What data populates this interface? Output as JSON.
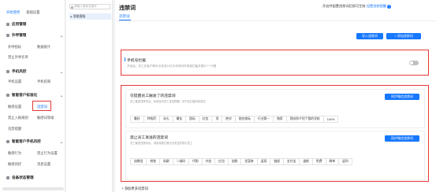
{
  "sidebar": {
    "groups": [
      {
        "label": "应用管理"
      },
      {
        "label": "外呼管理",
        "subs": [
          "外呼指标",
          "数据统计",
          "禁止外呼名单"
        ]
      },
      {
        "label": "手机风控",
        "subs": [
          "手机设置",
          "手机权限"
        ]
      },
      {
        "label": "智能客户标准化",
        "subs": [
          "敏感设置",
          "违禁词",
          "禁止入群规则",
          "敏感词等级",
          "违禁提醒"
        ]
      },
      {
        "label": "智能客户手机风控",
        "subs": [
          "敏感行为",
          "禁止行为设置",
          "敏感风控",
          "消息设置"
        ]
      },
      {
        "label": "设备状态管理"
      }
    ],
    "top_items": [
      "开始使用",
      "基础设置"
    ]
  },
  "midpanel": {
    "search_placeholder": "请输入搜索关键字",
    "tree_root": "智能客服"
  },
  "main": {
    "title": "违禁词",
    "hint": "开启并配置违禁词后即可生效·",
    "hint_link": "设置违禁提醒",
    "hint_q": "?",
    "tab": "违禁词",
    "btn_import": "导入违禁词",
    "btn_add": "+ 添加违禁词",
    "sec1_label": "手机号拦截",
    "sec1_desc": "开启后，员工在客户聊天中发送11位手机号码时将被拦截并提示\"**\"代替",
    "card1": {
      "title": "仅提醒员工触发了的违禁词",
      "desc": "员工触发违禁词后，系统会向员工发送提醒，但不会拦截消息发送",
      "btn": "同步微信违禁词",
      "tags": [
        "最好",
        "特效药",
        "永久",
        "最佳",
        "国际",
        "红包",
        "顶",
        "绝对",
        "驰名商标",
        "行业第一",
        "独家",
        "我向你介绍个我的学校",
        "100%"
      ]
    },
    "card2": {
      "title": "禁止员工发送的违禁词",
      "desc": "员工触发违禁词后，消息将被拦截无法发送并提示员工",
      "btn": "同步微信违禁词",
      "tags": [
        "加微信",
        "转账",
        "私聊",
        "二维码",
        "代购",
        "外挂",
        "红包",
        "加群",
        "优惠券",
        "返现",
        "链接",
        "支付宝",
        "退款",
        "免费",
        "刷单",
        "返利"
      ]
    },
    "bottom": "+ 添加更多违禁词"
  }
}
